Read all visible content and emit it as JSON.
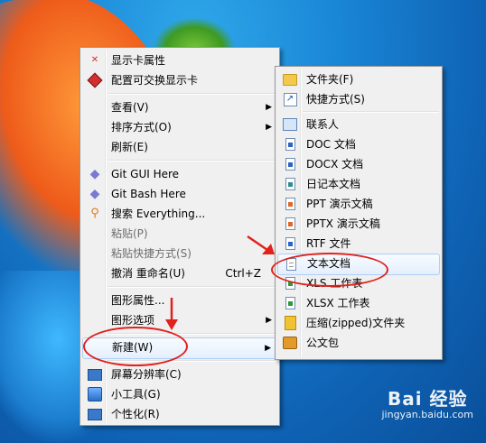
{
  "main_menu": [
    {
      "type": "item",
      "label": "显示卡属性",
      "icon": "nvidia-icon"
    },
    {
      "type": "item",
      "label": "配置可交换显示卡",
      "icon": "switchable-graphics-icon"
    },
    {
      "type": "sep"
    },
    {
      "type": "item",
      "label": "查看(V)",
      "submenu": true
    },
    {
      "type": "item",
      "label": "排序方式(O)",
      "submenu": true
    },
    {
      "type": "item",
      "label": "刷新(E)"
    },
    {
      "type": "sep"
    },
    {
      "type": "item",
      "label": "Git GUI Here",
      "icon": "git-gui-icon"
    },
    {
      "type": "item",
      "label": "Git Bash Here",
      "icon": "git-bash-icon"
    },
    {
      "type": "item",
      "label": "搜索 Everything...",
      "icon": "search-icon"
    },
    {
      "type": "item",
      "label": "粘贴(P)",
      "disabled": true
    },
    {
      "type": "item",
      "label": "粘贴快捷方式(S)",
      "disabled": true
    },
    {
      "type": "item",
      "label": "撤消 重命名(U)",
      "shortcut": "Ctrl+Z"
    },
    {
      "type": "sep"
    },
    {
      "type": "item",
      "label": "图形属性..."
    },
    {
      "type": "item",
      "label": "图形选项",
      "submenu": true
    },
    {
      "type": "sep"
    },
    {
      "type": "item",
      "label": "新建(W)",
      "submenu": true,
      "highlighted": true
    },
    {
      "type": "sep"
    },
    {
      "type": "item",
      "label": "屏幕分辨率(C)",
      "icon": "monitor-icon"
    },
    {
      "type": "item",
      "label": "小工具(G)",
      "icon": "gadget-icon"
    },
    {
      "type": "item",
      "label": "个性化(R)",
      "icon": "personalize-icon"
    }
  ],
  "new_submenu": [
    {
      "type": "item",
      "label": "文件夹(F)",
      "icon": "folder-icon"
    },
    {
      "type": "item",
      "label": "快捷方式(S)",
      "icon": "shortcut-icon"
    },
    {
      "type": "sep"
    },
    {
      "type": "item",
      "label": "联系人",
      "icon": "contact-icon"
    },
    {
      "type": "item",
      "label": "DOC 文档",
      "icon": "doc-icon"
    },
    {
      "type": "item",
      "label": "DOCX 文档",
      "icon": "docx-icon"
    },
    {
      "type": "item",
      "label": "日记本文档",
      "icon": "journal-icon"
    },
    {
      "type": "item",
      "label": "PPT 演示文稿",
      "icon": "ppt-icon"
    },
    {
      "type": "item",
      "label": "PPTX 演示文稿",
      "icon": "pptx-icon"
    },
    {
      "type": "item",
      "label": "RTF 文件",
      "icon": "rtf-icon"
    },
    {
      "type": "item",
      "label": "文本文档",
      "icon": "text-document-icon",
      "highlighted": true
    },
    {
      "type": "item",
      "label": "XLS 工作表",
      "icon": "xls-icon"
    },
    {
      "type": "item",
      "label": "XLSX 工作表",
      "icon": "xlsx-icon"
    },
    {
      "type": "item",
      "label": "压缩(zipped)文件夹",
      "icon": "zip-folder-icon"
    },
    {
      "type": "item",
      "label": "公文包",
      "icon": "briefcase-icon"
    }
  ],
  "watermark": {
    "brand": "Bai 经验",
    "url": "jingyan.baidu.com"
  },
  "colors": {
    "annotation": "#e0211c",
    "menu_bg": "#f0f0f0",
    "highlight_border": "#aecff7"
  }
}
